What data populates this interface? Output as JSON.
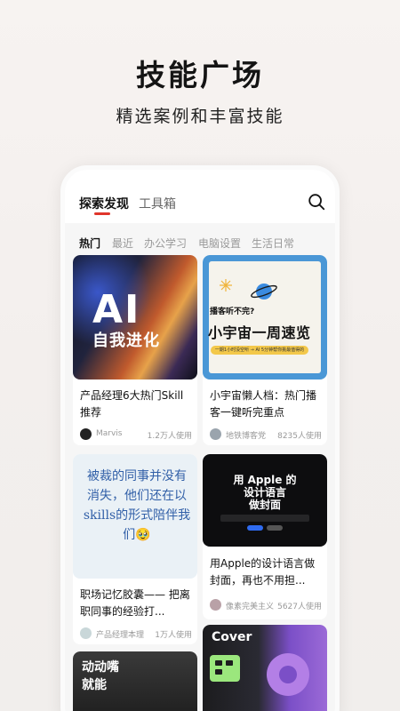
{
  "hero": {
    "title": "技能广场",
    "subtitle": "精选案例和丰富技能"
  },
  "header": {
    "tabs": [
      {
        "label": "探索发现",
        "active": true
      },
      {
        "label": "工具箱",
        "active": false
      }
    ],
    "search_icon": "search-icon"
  },
  "categories": [
    {
      "label": "热门",
      "active": true
    },
    {
      "label": "最近",
      "active": false
    },
    {
      "label": "办公学习",
      "active": false
    },
    {
      "label": "电脑设置",
      "active": false
    },
    {
      "label": "生活日常",
      "active": false
    }
  ],
  "cards": [
    {
      "thumb": {
        "big": "AI",
        "sub": "自我进化"
      },
      "title": "产品经理6大热门Skill推荐",
      "author": "Marvis",
      "usage": "1.2万人使用"
    },
    {
      "thumb": {
        "question": "播客听不完?",
        "big": "小宇宙一周速览",
        "bar": "一期1小时没空听 → AI 5分钟帮你挑最值得的"
      },
      "title": "小宇宙懒人档：热门播客一键听完重点",
      "author": "地铁博客党",
      "usage": "8235人使用"
    },
    {
      "thumb": {
        "verse": "被裁的同事并没有消失，他们还在以skills的形式陪伴我们🥹"
      },
      "title": "职场记忆胶囊—— 把离职同事的经验打...",
      "author": "产品经理本理",
      "usage": "1万人使用"
    },
    {
      "thumb": {
        "line1": "用 Apple 的",
        "line2": "设计语言",
        "line3": "做封面"
      },
      "title": "用Apple的设计语言做封面，再也不用担...",
      "author": "像素完美主义",
      "usage": "5627人使用"
    },
    {
      "thumb": {
        "text": "Cover"
      }
    },
    {
      "thumb": {
        "line1": "动动嘴",
        "line2": "就能"
      }
    }
  ],
  "colors": {
    "accent": "#e0352b",
    "verse": "#3260a8",
    "pod_bg": "#4a97d6"
  }
}
